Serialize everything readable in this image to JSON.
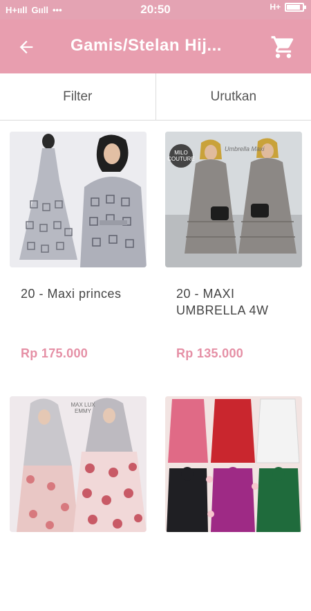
{
  "status_bar": {
    "signal_left": "H+ııll",
    "signal_mid": "Gııll",
    "more": "•••",
    "time": "20:50",
    "network_right": "H+",
    "battery_level": 0.8,
    "icons": [
      "signal-icon",
      "battery-icon"
    ]
  },
  "app_bar": {
    "title": "Gamis/Stelan Hij...",
    "back_icon": "arrow-left-icon",
    "cart_icon": "cart-icon",
    "color": "#e89eaf"
  },
  "tabs": [
    {
      "label": "Filter"
    },
    {
      "label": "Urutkan"
    }
  ],
  "products": [
    {
      "name": "20 - Maxi princes",
      "price": "Rp 175.000",
      "image": "gray-patterned-gown"
    },
    {
      "name": "20 - MAXI UMBRELLA 4W",
      "price": "Rp 135.000",
      "image": "gray-tiered-dress",
      "badge": "MILO COUTURE",
      "watermark": "Umbrella Maxi"
    },
    {
      "name": "",
      "price": "",
      "image": "floral-dress",
      "watermark": "MAX LUX EMMY"
    },
    {
      "name": "",
      "price": "",
      "image": "colorful-dresses"
    }
  ],
  "colors": {
    "accent": "#e89eaf",
    "price": "#e58fa5",
    "text": "#444444"
  }
}
